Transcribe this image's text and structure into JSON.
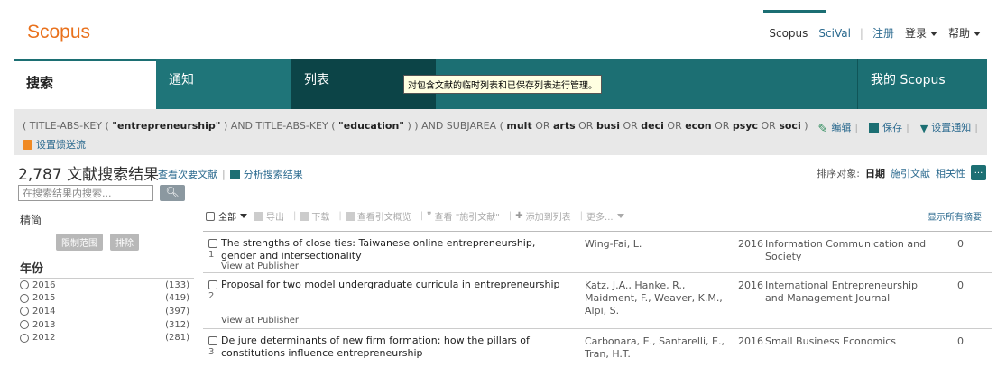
{
  "header": {
    "logo": "Scopus",
    "nav": {
      "scopus": "Scopus",
      "scival": "SciVal",
      "register": "注册",
      "login": "登录",
      "help": "帮助"
    }
  },
  "tabs": {
    "search": "搜索",
    "alerts": "通知",
    "lists": "列表",
    "tooltip": "对包含文献的临时列表和已保存列表进行管理。",
    "mine": "我的 Scopus"
  },
  "query": {
    "parts": [
      {
        "t": "( TITLE-ABS-KEY ( ",
        "b": false
      },
      {
        "t": "\"entrepreneurship\"",
        "b": true
      },
      {
        "t": " ) AND TITLE-ABS-KEY ( ",
        "b": false
      },
      {
        "t": "\"education\"",
        "b": true
      },
      {
        "t": " ) ) AND SUBJAREA ( ",
        "b": false
      },
      {
        "t": "mult",
        "b": true
      },
      {
        "t": " OR ",
        "b": false
      },
      {
        "t": "arts",
        "b": true
      },
      {
        "t": " OR ",
        "b": false
      },
      {
        "t": "busi",
        "b": true
      },
      {
        "t": " OR ",
        "b": false
      },
      {
        "t": "deci",
        "b": true
      },
      {
        "t": " OR ",
        "b": false
      },
      {
        "t": "econ",
        "b": true
      },
      {
        "t": " OR ",
        "b": false
      },
      {
        "t": "psyc",
        "b": true
      },
      {
        "t": " OR ",
        "b": false
      },
      {
        "t": "soci",
        "b": true
      },
      {
        "t": " )",
        "b": false
      }
    ],
    "rss": "设置馈送流",
    "edit": "编辑",
    "save": "保存",
    "alert": "设置通知"
  },
  "results": {
    "count": "2,787 文献搜索结果",
    "secondary": "查看次要文献",
    "analyze": "分析搜索结果",
    "sort_label": "排序对象:",
    "sort_date": "日期",
    "sort_cited": "施引文献",
    "sort_relevance": "相关性",
    "more": "..."
  },
  "sidebar": {
    "search_placeholder": "在搜索结果内搜索...",
    "refine": "精简",
    "limit": "限制范围",
    "exclude": "排除",
    "year_heading": "年份",
    "years": [
      {
        "year": "2016",
        "count": "(133)"
      },
      {
        "year": "2015",
        "count": "(419)"
      },
      {
        "year": "2014",
        "count": "(397)"
      },
      {
        "year": "2013",
        "count": "(312)"
      },
      {
        "year": "2012",
        "count": "(281)"
      }
    ]
  },
  "toolbar": {
    "all": "全部",
    "export": "导出",
    "download": "下载",
    "citation_overview": "查看引文概览",
    "cited_by": "查看 \"施引文献\"",
    "add_to_list": "添加到列表",
    "more": "更多...",
    "show_abstracts": "显示所有摘要"
  },
  "documents": [
    {
      "num": "1",
      "title": "The strengths of close ties: Taiwanese online entrepreneurship, gender and intersectionality",
      "authors": "Wing-Fai, L.",
      "year": "2016",
      "source": "Information Communication and Society",
      "cited": "0",
      "publisher": "View at Publisher"
    },
    {
      "num": "2",
      "title": "Proposal for two model undergraduate curricula in entrepreneurship",
      "authors": "Katz, J.A., Hanke, R., Maidment, F., Weaver, K.M., Alpi, S.",
      "year": "2016",
      "source": "International Entrepreneurship and Management Journal",
      "cited": "0",
      "publisher": "View at Publisher"
    },
    {
      "num": "3",
      "title": "De jure determinants of new firm formation: how the pillars of constitutions influence entrepreneurship",
      "authors": "Carbonara, E., Santarelli, E., Tran, H.T.",
      "year": "2016",
      "source": "Small Business Economics",
      "cited": "0",
      "publisher": ""
    }
  ]
}
